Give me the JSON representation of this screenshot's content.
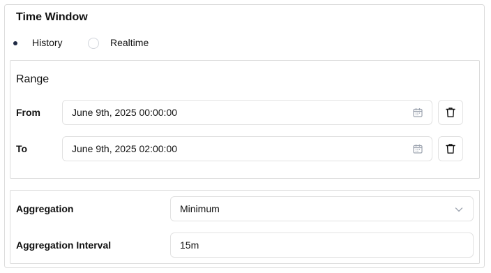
{
  "title": "Time Window",
  "mode": {
    "options": [
      {
        "label": "History",
        "selected": true
      },
      {
        "label": "Realtime",
        "selected": false
      }
    ]
  },
  "range": {
    "title": "Range",
    "from": {
      "label": "From",
      "value": "June 9th, 2025 00:00:00"
    },
    "to": {
      "label": "To",
      "value": "June 9th, 2025 02:00:00"
    },
    "icons": {
      "date": "calendar-icon",
      "clear": "trash-icon"
    }
  },
  "aggregation": {
    "label": "Aggregation",
    "selected": "Minimum",
    "interval_label": "Aggregation Interval",
    "interval_value": "15m",
    "icons": {
      "dropdown": "chevron-down-icon"
    }
  },
  "colors": {
    "border": "#dcdcdc",
    "text": "#111111",
    "radio_selected": "#1f2a44",
    "icon": "#9ca3af"
  }
}
